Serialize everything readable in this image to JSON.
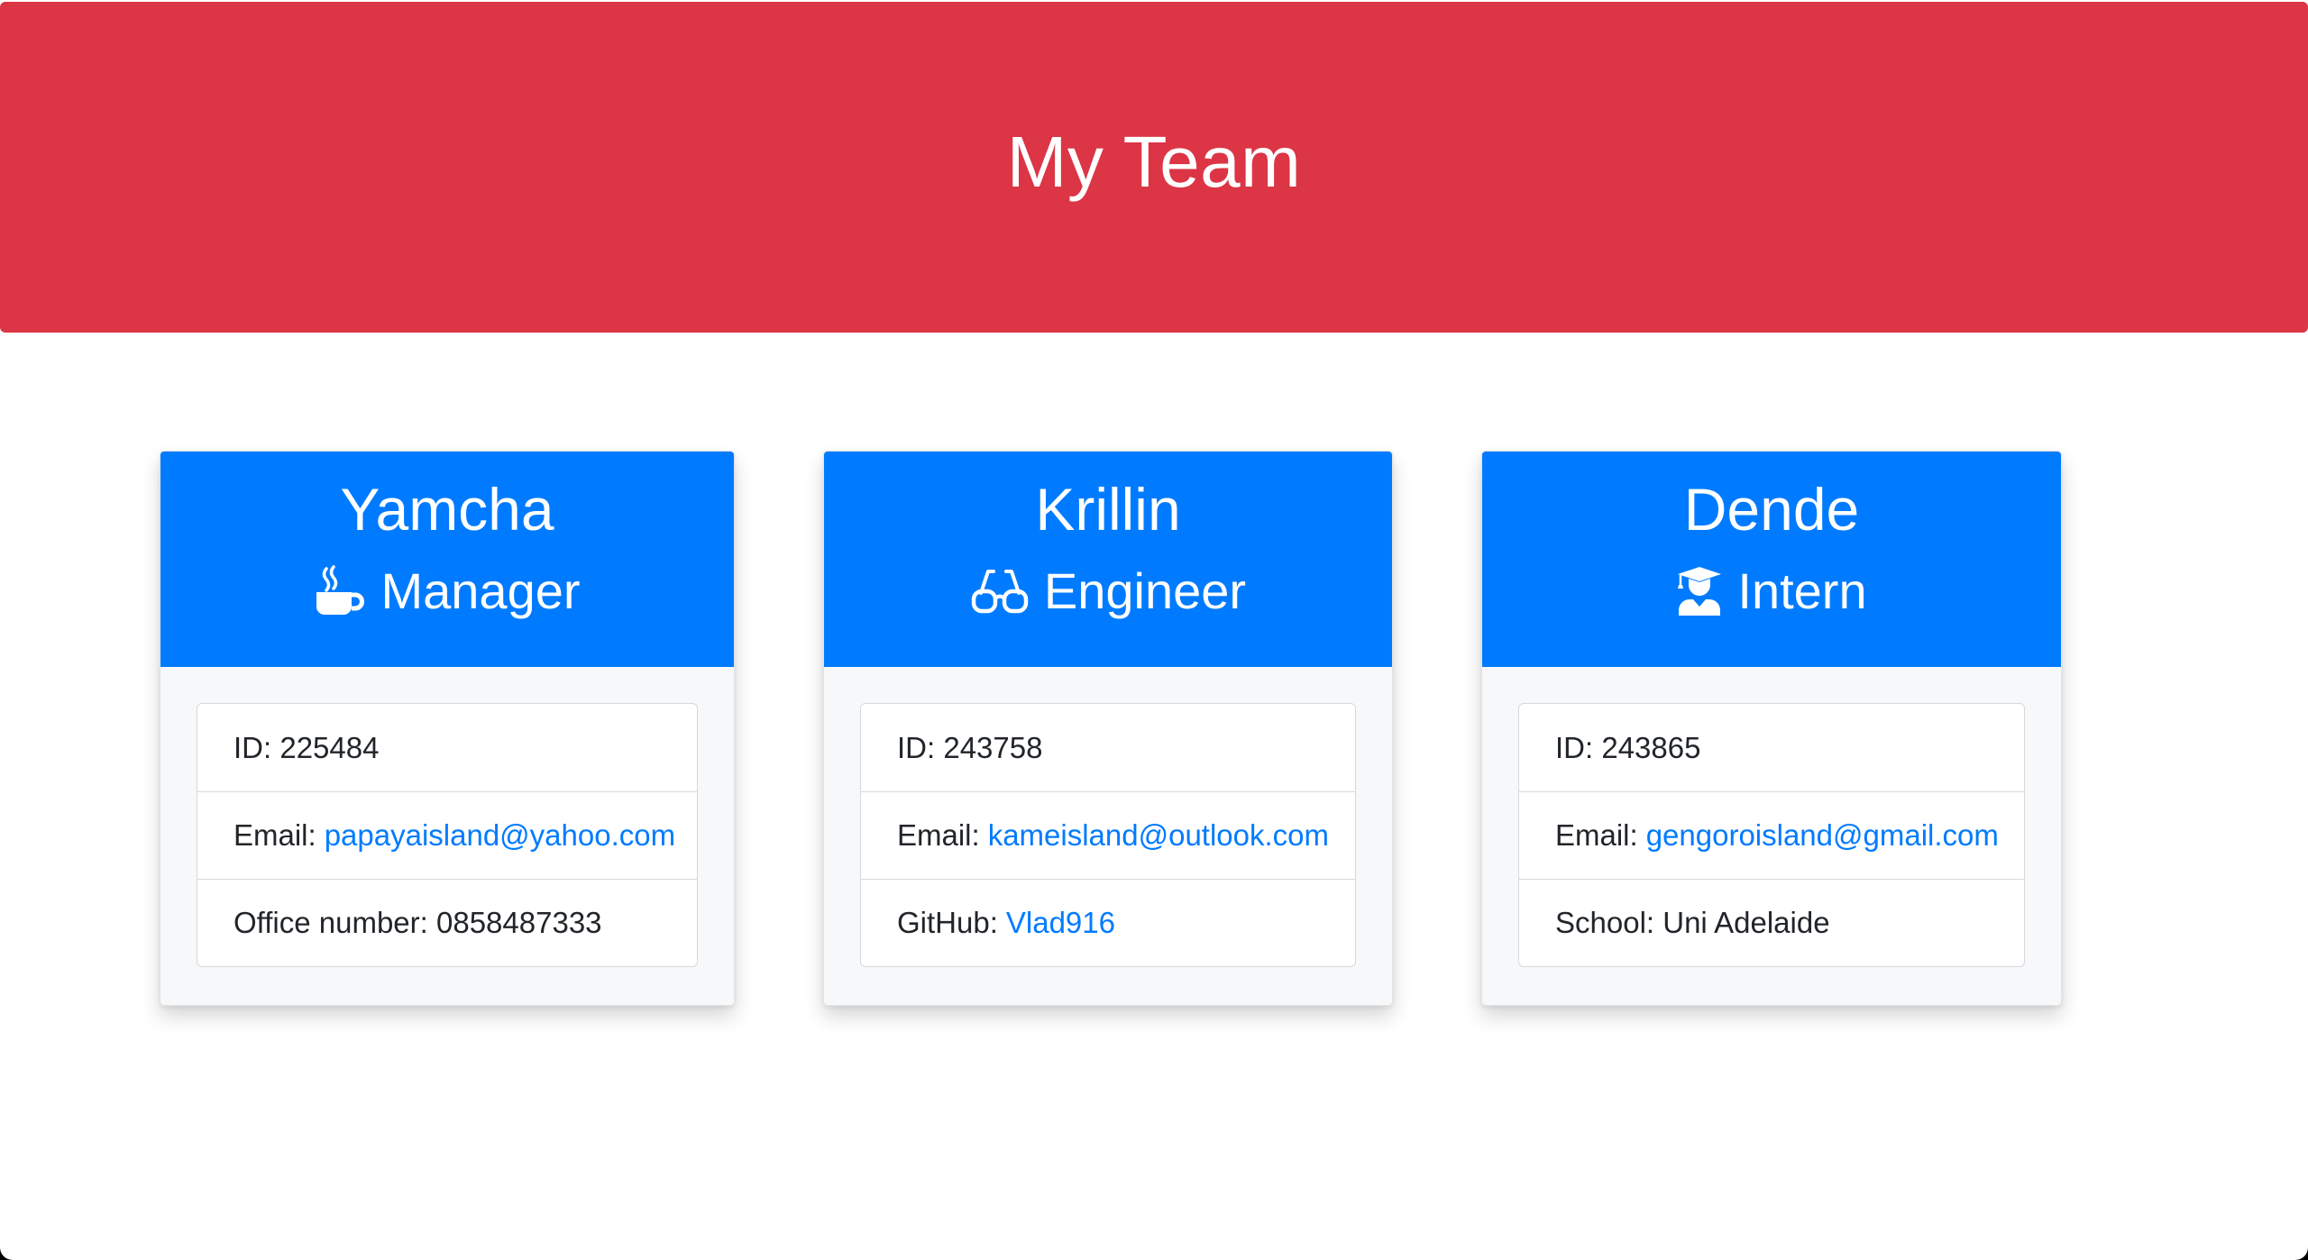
{
  "header": {
    "title": "My Team"
  },
  "colors": {
    "header_bg": "#dc3545",
    "card_header_bg": "#007bff",
    "link": "#007bff"
  },
  "employees": [
    {
      "name": "Yamcha",
      "role": "Manager",
      "role_icon": "coffee-mug-icon",
      "id_label": "ID:",
      "id": "225484",
      "email_label": "Email:",
      "email": "papayaisland@yahoo.com",
      "extra_label": "Office number:",
      "extra_value": "0858487333"
    },
    {
      "name": "Krillin",
      "role": "Engineer",
      "role_icon": "glasses-icon",
      "id_label": "ID:",
      "id": "243758",
      "email_label": "Email:",
      "email": "kameisland@outlook.com",
      "extra_label": "GitHub:",
      "extra_value": "Vlad916"
    },
    {
      "name": "Dende",
      "role": "Intern",
      "role_icon": "graduate-icon",
      "id_label": "ID:",
      "id": "243865",
      "email_label": "Email:",
      "email": "gengoroisland@gmail.com",
      "extra_label": "School:",
      "extra_value": "Uni Adelaide"
    }
  ]
}
